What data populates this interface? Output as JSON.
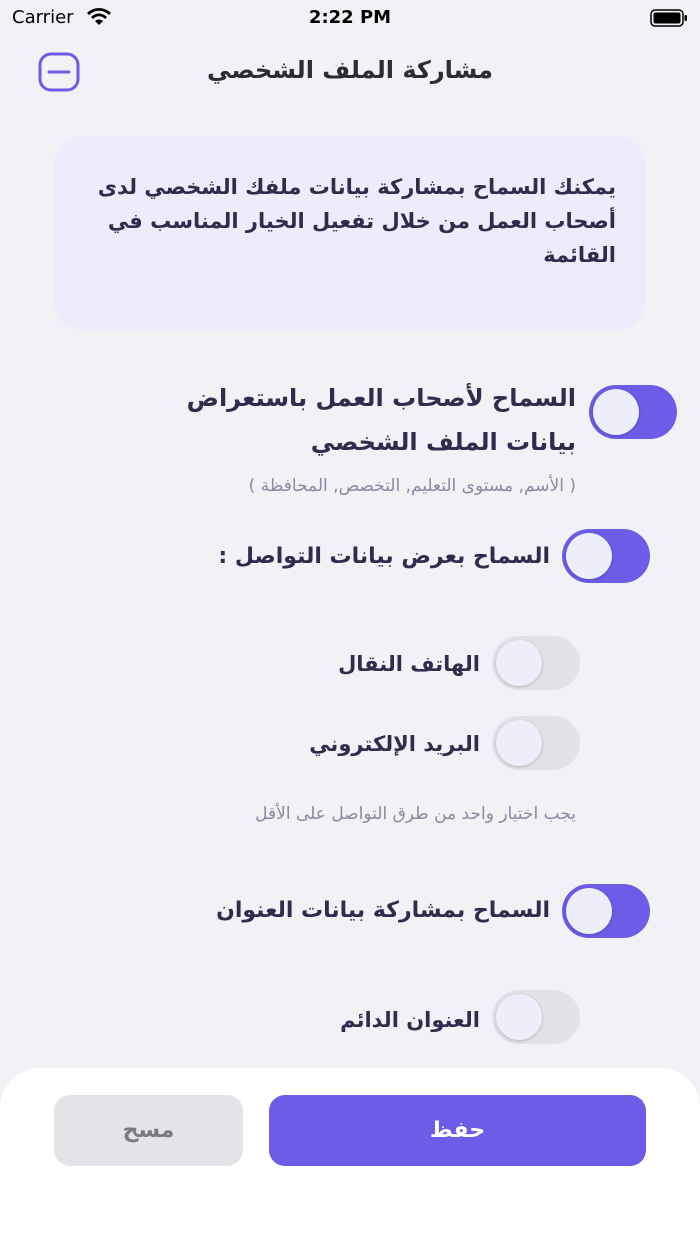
{
  "status_bar": {
    "carrier": "Carrier",
    "time": "2:22 PM"
  },
  "header": {
    "title": "مشاركة الملف الشخصي"
  },
  "info_card": {
    "text": "يمكنك السماح بمشاركة بيانات ملفك الشخصي لدى أصحاب العمل من خلال تفعيل الخيار المناسب في القائمة"
  },
  "settings": {
    "profile": {
      "label": "السماح لأصحاب العمل باستعراض بيانات الملف الشخصي",
      "hint": "( الأسم, مستوى التعليم, التخصص, المحافظة )",
      "enabled": true
    },
    "contact": {
      "label": "السماح بعرض بيانات التواصل :",
      "enabled": true
    },
    "mobile": {
      "label": "الهاتف النقال",
      "enabled": false
    },
    "email": {
      "label": "البريد الإلكتروني",
      "enabled": false
    },
    "contact_hint": "يجب اختيار واحد من طرق التواصل على الأقل",
    "address": {
      "label": "السماح بمشاركة بيانات العنوان",
      "enabled": true
    },
    "permanent_address": {
      "label": "العنوان الدائم",
      "enabled": false
    }
  },
  "actions": {
    "save_label": "حفظ",
    "clear_label": "مسح"
  },
  "colors": {
    "accent": "#6C5CE7",
    "background": "#F2F2F6",
    "card": "#ECECFB",
    "toggle_off": "#E2E2E6"
  }
}
